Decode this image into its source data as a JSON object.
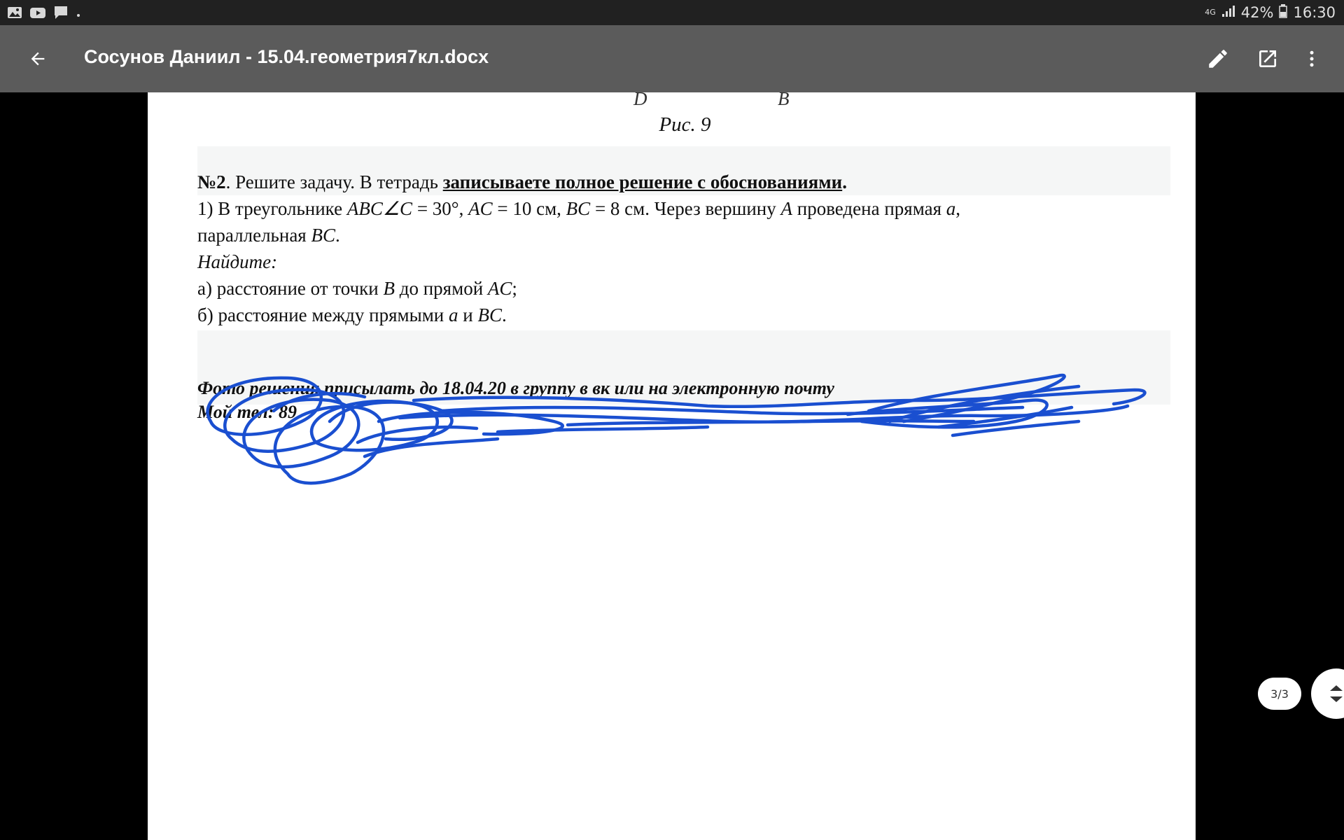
{
  "status_bar": {
    "left_icons": [
      "image-icon",
      "youtube-icon",
      "chat-icon",
      "dot-icon"
    ],
    "network_type": "4G",
    "battery": "42%",
    "time": "16:30"
  },
  "app_bar": {
    "title": "Сосунов Даниил - 15.04.геометрия7кл.docx",
    "actions": [
      "edit-icon",
      "open-in-new-icon",
      "more-vert-icon"
    ]
  },
  "document": {
    "figure_letters": [
      "D",
      "B"
    ],
    "figure_caption": "Рис. 9",
    "task_number": "№2",
    "task_intro": ". Решите задачу.  В тетрадь ",
    "task_emphasis": "записываете полное решение с обоснованиями",
    "task_end": ".",
    "line1_parts": [
      "1) В треугольнике ",
      "ABC∠C",
      " = 30°, ",
      "AC",
      " = 10 см, ",
      "BC",
      " = 8 см. Через  вершину ",
      "A",
      " проведена прямая ",
      "a",
      ","
    ],
    "line2_parts": [
      "параллельная ",
      "BC",
      "."
    ],
    "find_label": "Найдите:",
    "item_a_parts": [
      "а) расстояние от точки ",
      "B",
      " до прямой ",
      "AC",
      ";"
    ],
    "item_b_parts": [
      "б) расстояние между прямыми ",
      "a",
      " и ",
      "BC",
      "."
    ],
    "footer_line1": "Фото решения присылать до 18.04.20 в группу в вк или на электронную почту",
    "footer_line2": "Мой тел: 89"
  },
  "page_indicator": "3/3",
  "colors": {
    "status_bar": "#212121",
    "app_bar": "#5b5b5b",
    "scribble": "#1a4fd0",
    "shade": "#f5f6f6"
  }
}
